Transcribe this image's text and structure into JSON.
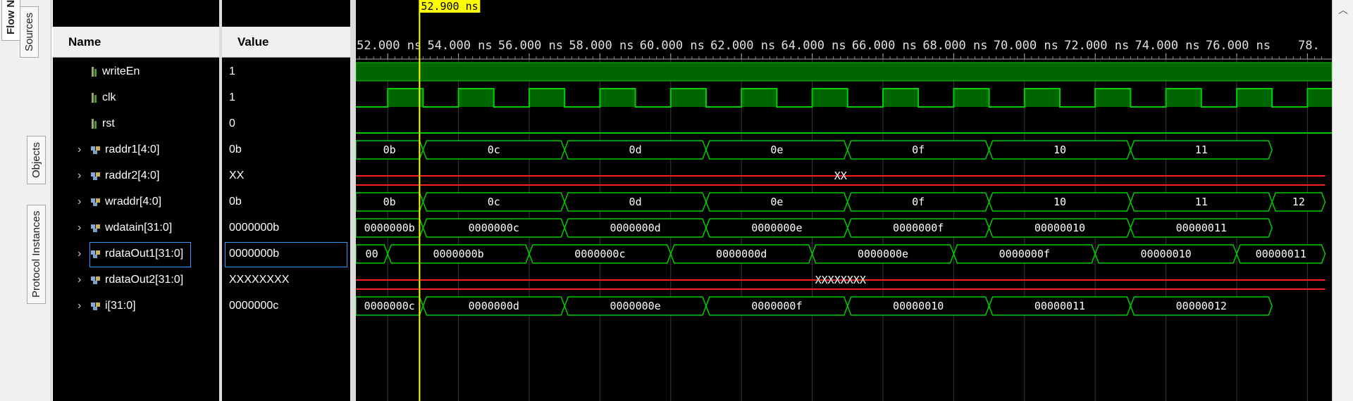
{
  "side_tabs": [
    "Flow N",
    "Sources",
    "Objects",
    "Protocol Instances"
  ],
  "columns": {
    "name": "Name",
    "value": "Value"
  },
  "cursor": {
    "label": "52.900 ns",
    "time": 52.9
  },
  "timeline": {
    "labels": [
      "52.000 ns",
      "54.000 ns",
      "56.000 ns",
      "58.000 ns",
      "60.000 ns",
      "62.000 ns",
      "64.000 ns",
      "66.000 ns",
      "68.000 ns",
      "70.000 ns",
      "72.000 ns",
      "74.000 ns",
      "76.000 ns",
      "78."
    ]
  },
  "signals": [
    {
      "name": "writeEn",
      "value": "1",
      "kind": "bit",
      "expandable": false
    },
    {
      "name": "clk",
      "value": "1",
      "kind": "bit",
      "expandable": false
    },
    {
      "name": "rst",
      "value": "0",
      "kind": "bit",
      "expandable": false
    },
    {
      "name": "raddr1[4:0]",
      "value": "0b",
      "kind": "bus",
      "expandable": true
    },
    {
      "name": "raddr2[4:0]",
      "value": "XX",
      "kind": "bus",
      "expandable": true
    },
    {
      "name": "wraddr[4:0]",
      "value": "0b",
      "kind": "bus",
      "expandable": true
    },
    {
      "name": "wdatain[31:0]",
      "value": "0000000b",
      "kind": "bus",
      "expandable": true
    },
    {
      "name": "rdataOut1[31:0]",
      "value": "0000000b",
      "kind": "bus",
      "expandable": true,
      "selected": true
    },
    {
      "name": "rdataOut2[31:0]",
      "value": "XXXXXXXX",
      "kind": "bus",
      "expandable": true
    },
    {
      "name": "i[31:0]",
      "value": "0000000c",
      "kind": "bus",
      "expandable": true
    }
  ],
  "waves": [
    {
      "type": "high"
    },
    {
      "type": "clock"
    },
    {
      "type": "low"
    },
    {
      "type": "bus",
      "segs": [
        [
          "0b",
          51.1,
          53.0
        ],
        [
          "0c",
          53.0,
          57.0
        ],
        [
          "0d",
          57.0,
          61.0
        ],
        [
          "0e",
          61.0,
          65.0
        ],
        [
          "0f",
          65.0,
          69.0
        ],
        [
          "10",
          69.0,
          73.0
        ],
        [
          "11",
          73.0,
          77.0
        ]
      ]
    },
    {
      "type": "x",
      "segs": [
        [
          "XX",
          51.1,
          78.5
        ]
      ]
    },
    {
      "type": "bus",
      "segs": [
        [
          "0b",
          51.1,
          53.0
        ],
        [
          "0c",
          53.0,
          57.0
        ],
        [
          "0d",
          57.0,
          61.0
        ],
        [
          "0e",
          61.0,
          65.0
        ],
        [
          "0f",
          65.0,
          69.0
        ],
        [
          "10",
          69.0,
          73.0
        ],
        [
          "11",
          73.0,
          77.0
        ],
        [
          "12",
          77.0,
          78.5
        ]
      ]
    },
    {
      "type": "bus",
      "segs": [
        [
          "0000000b",
          51.1,
          53.0
        ],
        [
          "0000000c",
          53.0,
          57.0
        ],
        [
          "0000000d",
          57.0,
          61.0
        ],
        [
          "0000000e",
          61.0,
          65.0
        ],
        [
          "0000000f",
          65.0,
          69.0
        ],
        [
          "00000010",
          69.0,
          73.0
        ],
        [
          "00000011",
          73.0,
          77.0
        ]
      ]
    },
    {
      "type": "bus",
      "segs": [
        [
          "00",
          51.1,
          52.0
        ],
        [
          "0000000b",
          52.0,
          56.0
        ],
        [
          "0000000c",
          56.0,
          60.0
        ],
        [
          "0000000d",
          60.0,
          64.0
        ],
        [
          "0000000e",
          64.0,
          68.0
        ],
        [
          "0000000f",
          68.0,
          72.0
        ],
        [
          "00000010",
          72.0,
          76.0
        ],
        [
          "00000011",
          76.0,
          78.5
        ]
      ]
    },
    {
      "type": "x",
      "segs": [
        [
          "XXXXXXXX",
          51.1,
          78.5
        ]
      ]
    },
    {
      "type": "bus",
      "segs": [
        [
          "0000000c",
          51.1,
          53.0
        ],
        [
          "0000000d",
          53.0,
          57.0
        ],
        [
          "0000000e",
          57.0,
          61.0
        ],
        [
          "0000000f",
          61.0,
          65.0
        ],
        [
          "00000010",
          65.0,
          69.0
        ],
        [
          "00000011",
          69.0,
          73.0
        ],
        [
          "00000012",
          73.0,
          77.0
        ]
      ]
    }
  ],
  "colors": {
    "wave_green": "#00cc00",
    "fill_green": "#006600",
    "bus_fill": "#000000",
    "x_red": "#ff2020",
    "cursor_yellow": "#ffff00",
    "grid": "#3a3a3a",
    "background": "#000000"
  },
  "icons": {
    "bit": "signal-bit-icon",
    "bus": "signal-bus-icon",
    "expand": "chevron-right-icon",
    "scroll": "scroll-up-icon"
  }
}
